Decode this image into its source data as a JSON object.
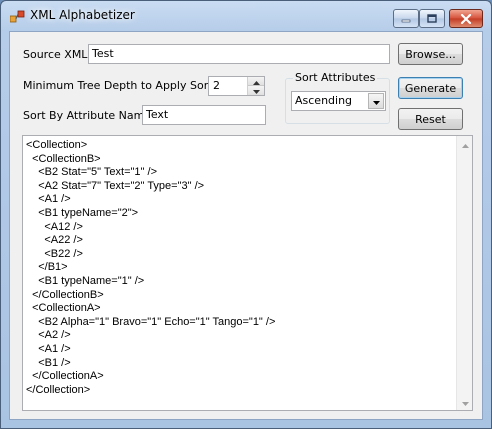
{
  "window": {
    "title": "XML Alphabetizer",
    "app_icon": "xml-app-icon",
    "controls": {
      "minimize": "minimize-icon",
      "maximize": "maximize-icon",
      "close": "close-icon"
    }
  },
  "form": {
    "source_xml_label": "Source XML",
    "source_xml_value": "Test",
    "browse_label": "Browse...",
    "min_depth_label": "Minimum Tree Depth to Apply Sort At",
    "min_depth_value": "2",
    "sort_attr_name_label": "Sort By Attribute Name",
    "sort_attr_name_value": "Text",
    "sort_attributes_group": "Sort Attributes",
    "sort_attributes_selected": "Ascending",
    "generate_label": "Generate",
    "reset_label": "Reset"
  },
  "output_lines": [
    "<Collection>",
    "  <CollectionB>",
    "    <B2 Stat=\"5\" Text=\"1\" />",
    "    <A2 Stat=\"7\" Text=\"2\" Type=\"3\" />",
    "    <A1 />",
    "    <B1 typeName=\"2\">",
    "      <A12 />",
    "      <A22 />",
    "      <B22 />",
    "    </B1>",
    "    <B1 typeName=\"1\" />",
    "  </CollectionB>",
    "  <CollectionA>",
    "    <B2 Alpha=\"1\" Bravo=\"1\" Echo=\"1\" Tango=\"1\" />",
    "    <A2 />",
    "    <A1 />",
    "    <B1 />",
    "  </CollectionA>",
    "</Collection>"
  ]
}
